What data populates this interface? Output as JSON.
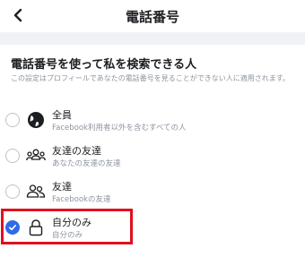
{
  "header": {
    "title": "電話番号",
    "back_icon": "chevron-left-icon"
  },
  "section": {
    "heading": "電話番号を使って私を検索できる人",
    "description": "この設定はプロフィールであなたの電話番号を見ることができない人に適用されます。"
  },
  "options": [
    {
      "label": "全員",
      "sublabel": "Facebook利用者以外を含むすべての人",
      "icon": "globe-icon",
      "selected": false
    },
    {
      "label": "友達の友達",
      "sublabel": "あなたの友達の友達",
      "icon": "friends-of-friends-icon",
      "selected": false
    },
    {
      "label": "友達",
      "sublabel": "Facebookの友達",
      "icon": "friends-icon",
      "selected": false
    },
    {
      "label": "自分のみ",
      "sublabel": "自分のみ",
      "icon": "lock-icon",
      "selected": true
    }
  ],
  "colors": {
    "accent": "#2d6ce6",
    "highlight_border": "#e01020",
    "secondary_text": "#8d949e",
    "divider_band": "#f0f2f5"
  }
}
